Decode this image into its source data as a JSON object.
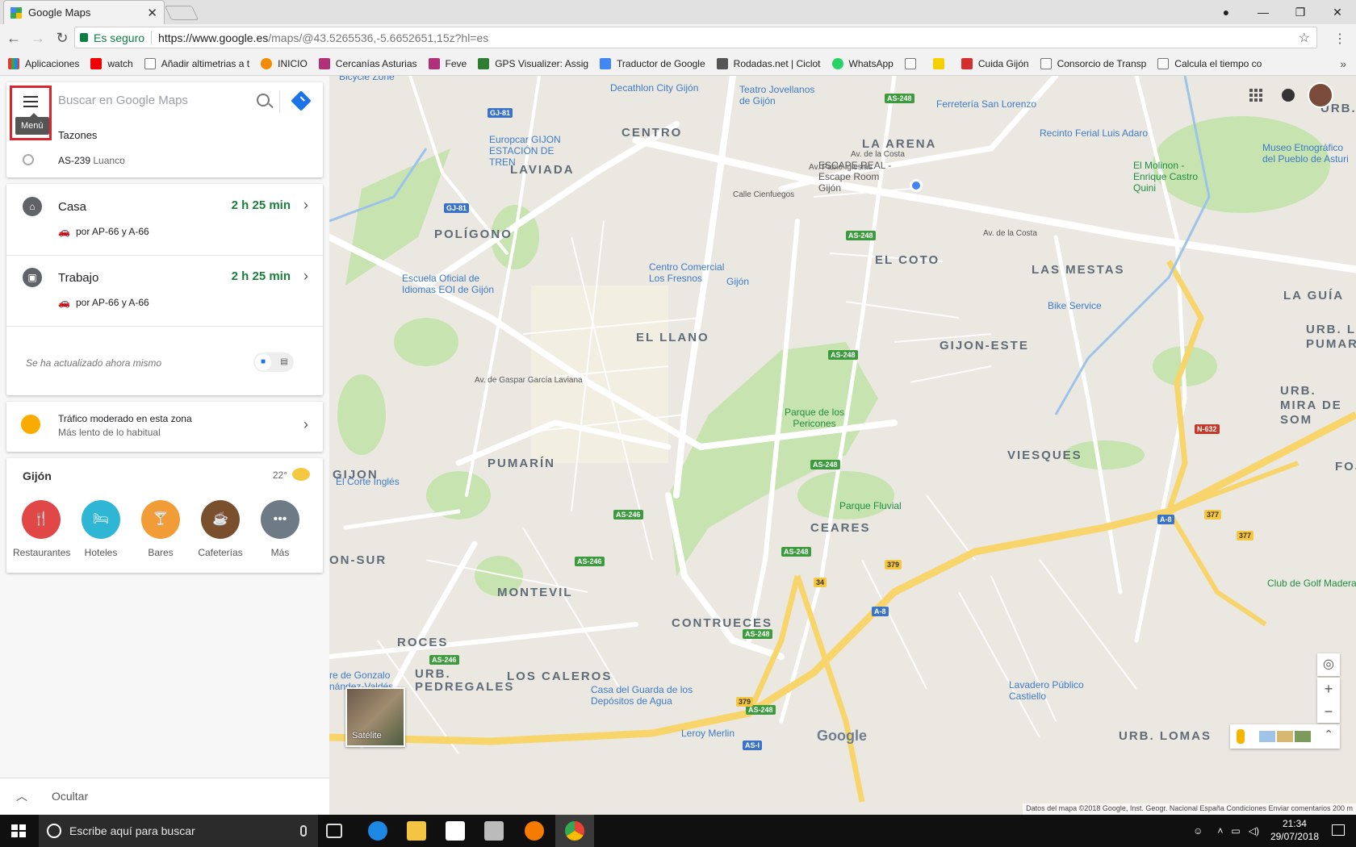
{
  "browser": {
    "tab_title": "Google Maps",
    "tab_close": "✕",
    "secure_label": "Es seguro",
    "url_host": "https://www.google.es",
    "url_rest": "/maps/@43.5265536,-5.6652651,15z?hl=es",
    "bookmarks": [
      "Aplicaciones",
      "watch",
      "Añadir altimetrias a t",
      "INICIO",
      "Cercanías Asturias",
      "Feve",
      "GPS Visualizer: Assig",
      "Traductor de Google",
      "Rodadas.net | Ciclot",
      "WhatsApp",
      "",
      "Cuida Gijón",
      "Consorcio de Transp",
      "Calcula el tiempo co"
    ]
  },
  "sidebar": {
    "menu_tooltip": "Menú",
    "search_placeholder": "Buscar en Google Maps",
    "suggestion_1": "Tazones",
    "suggestion_2_main": "AS-239",
    "suggestion_2_sub": "Luanco",
    "routes": [
      {
        "title": "Casa",
        "time": "2 h 25 min",
        "via": "por AP-66 y A-66"
      },
      {
        "title": "Trabajo",
        "time": "2 h 25 min",
        "via": "por AP-66 y A-66"
      }
    ],
    "updated_text": "Se ha actualizado ahora mismo",
    "traffic_title": "Tráfico moderado en esta zona",
    "traffic_sub": "Más lento de lo habitual",
    "city": "Gijón",
    "temperature": "22°",
    "categories": [
      {
        "label": "Restaurantes",
        "color": "#e04848"
      },
      {
        "label": "Hoteles",
        "color": "#2fb6d4"
      },
      {
        "label": "Bares",
        "color": "#f29c38"
      },
      {
        "label": "Cafeterías",
        "color": "#7a4f2e"
      },
      {
        "label": "Más",
        "color": "#6e7b87"
      }
    ],
    "hide_label": "Ocultar"
  },
  "map": {
    "areas": [
      "CENTRO",
      "LA ARENA",
      "LAVIADA",
      "POLÍGONO",
      "EL COTO",
      "LAS MESTAS",
      "EL LLANO",
      "GIJON-ESTE",
      "LA GUÍA",
      "URB. L PUMARA",
      "URB. MIRA DE SOM",
      "PUMARÍN",
      "VIESQUES",
      "CEARES",
      "MONTEVIL",
      "CONTRUECES",
      "ROCES",
      "URB. PEDREGALES",
      "LOS CALEROS",
      "URB. LOMAS",
      "ON-SUR",
      "GIJON",
      "URB. P",
      "FOJ"
    ],
    "pois": [
      "Decathlon City Gijón",
      "Teatro Jovellanos de Gijón",
      "Ferretería San Lorenzo",
      "Recinto Ferial Luis Adaro",
      "Museo Etnográfico del Pueblo de Asturi",
      "Europcar GIJON ESTACIÓN DE TREN",
      "ESCAPE REAL - Escape Room Gijón",
      "El Molinon - Enrique Castro Quini",
      "Escuela Oficial de Idiomas EOI de Gijón",
      "Centro Comercial Los Fresnos",
      "Gijón",
      "Bike Service",
      "Parque de los Pericones",
      "El Corte Inglés",
      "Parque Fluvial",
      "Club de Golf Madera",
      "Casa del Guarda de los Depósitos de Agua",
      "Lavadero Público Castiello",
      "Leroy Merlin",
      "Bicycle Zone",
      "re de Gonzalo nández-Valdés"
    ],
    "satellite_label": "Satélite",
    "logo": "Google",
    "attribution": "Datos del mapa ©2018 Google, Inst. Geogr. Nacional   España   Condiciones   Enviar comentarios   200 m"
  },
  "taskbar": {
    "search_placeholder": "Escribe aquí para buscar",
    "time": "21:34",
    "date": "29/07/2018"
  }
}
